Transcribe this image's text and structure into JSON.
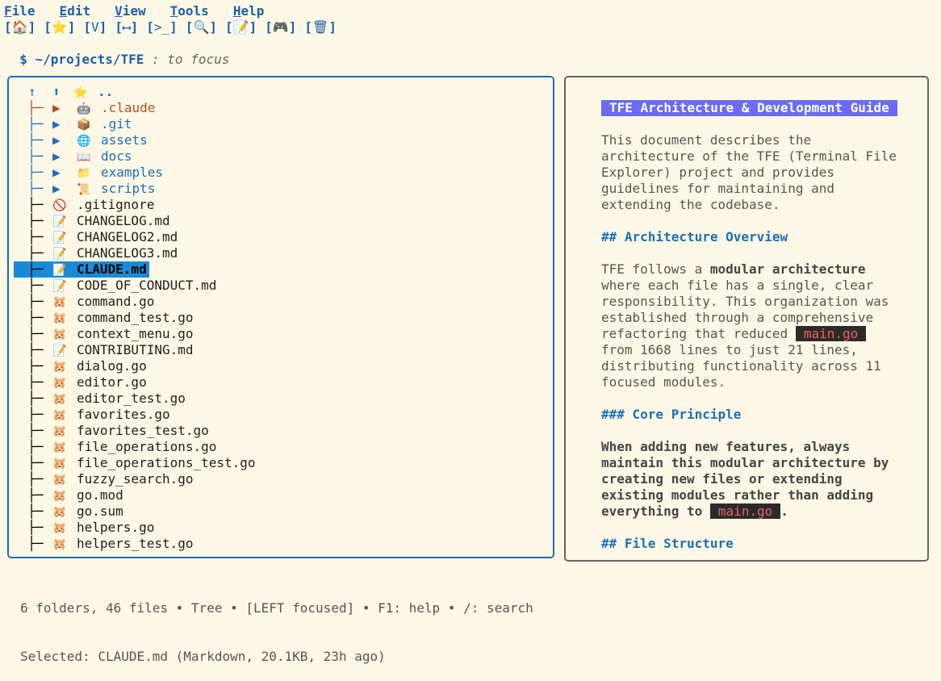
{
  "menu": [
    {
      "hotkey": "F",
      "rest": "ile"
    },
    {
      "hotkey": "E",
      "rest": "dit"
    },
    {
      "hotkey": "V",
      "rest": "iew"
    },
    {
      "hotkey": "T",
      "rest": "ools"
    },
    {
      "hotkey": "H",
      "rest": "elp"
    }
  ],
  "toolbar": [
    {
      "name": "home-button",
      "glyph": "🏠",
      "icon": "home-icon"
    },
    {
      "name": "favorites-button",
      "glyph": "⭐",
      "icon": "star-icon"
    },
    {
      "name": "view-button",
      "glyph": "V",
      "icon": "view-icon"
    },
    {
      "name": "toggle-panes-button",
      "glyph": "⟷",
      "icon": "arrows-icon"
    },
    {
      "name": "terminal-button",
      "glyph": ">_",
      "icon": "terminal-icon"
    },
    {
      "name": "search-button",
      "glyph": "🔍",
      "icon": "search-icon"
    },
    {
      "name": "edit-button",
      "glyph": "📝",
      "icon": "memo-icon"
    },
    {
      "name": "games-button",
      "glyph": "🎮",
      "icon": "gamepad-icon"
    },
    {
      "name": "trash-button",
      "glyph": "🗑",
      "icon": "trash-icon"
    }
  ],
  "command": {
    "prompt": "$ ~/projects/TFE",
    "hint": " : to focus"
  },
  "tree": {
    "parent": {
      "up": "↑",
      "top": "⬆",
      "icon": "⭐",
      "name": ".."
    },
    "rows": [
      {
        "kind": "claude",
        "arrow": "▶",
        "icon": "🤖",
        "name": ".claude"
      },
      {
        "kind": "folder",
        "arrow": "▶",
        "icon": "📦",
        "name": ".git"
      },
      {
        "kind": "folder",
        "arrow": "▶",
        "icon": "🌐",
        "name": "assets"
      },
      {
        "kind": "folder",
        "arrow": "▶",
        "icon": "📖",
        "name": "docs"
      },
      {
        "kind": "folder",
        "arrow": "▶",
        "icon": "📁",
        "name": "examples"
      },
      {
        "kind": "folder",
        "arrow": "▶",
        "icon": "📜",
        "name": "scripts"
      },
      {
        "kind": "file",
        "icon": "🚫",
        "name": ".gitignore"
      },
      {
        "kind": "file",
        "icon": "📝",
        "name": "CHANGELOG.md"
      },
      {
        "kind": "file",
        "icon": "📝",
        "name": "CHANGELOG2.md"
      },
      {
        "kind": "file",
        "icon": "📝",
        "name": "CHANGELOG3.md"
      },
      {
        "kind": "file",
        "icon": "📝",
        "name": "CLAUDE.md",
        "selected": true
      },
      {
        "kind": "file",
        "icon": "📝",
        "name": "CODE_OF_CONDUCT.md"
      },
      {
        "kind": "file",
        "icon": "🐹",
        "name": "command.go"
      },
      {
        "kind": "file",
        "icon": "🐹",
        "name": "command_test.go"
      },
      {
        "kind": "file",
        "icon": "🐹",
        "name": "context_menu.go"
      },
      {
        "kind": "file",
        "icon": "📝",
        "name": "CONTRIBUTING.md"
      },
      {
        "kind": "file",
        "icon": "🐹",
        "name": "dialog.go"
      },
      {
        "kind": "file",
        "icon": "🐹",
        "name": "editor.go"
      },
      {
        "kind": "file",
        "icon": "🐹",
        "name": "editor_test.go"
      },
      {
        "kind": "file",
        "icon": "🐹",
        "name": "favorites.go"
      },
      {
        "kind": "file",
        "icon": "🐹",
        "name": "favorites_test.go"
      },
      {
        "kind": "file",
        "icon": "🐹",
        "name": "file_operations.go"
      },
      {
        "kind": "file",
        "icon": "🐹",
        "name": "file_operations_test.go"
      },
      {
        "kind": "file",
        "icon": "🐹",
        "name": "fuzzy_search.go"
      },
      {
        "kind": "file",
        "icon": "🐹",
        "name": "go.mod"
      },
      {
        "kind": "file",
        "icon": "🐹",
        "name": "go.sum"
      },
      {
        "kind": "file",
        "icon": "🐹",
        "name": "helpers.go"
      },
      {
        "kind": "file",
        "icon": "🐹",
        "name": "helpers_test.go"
      }
    ]
  },
  "preview": {
    "lines": [
      [
        {
          "t": "title",
          "v": "TFE Architecture & Development Guide"
        }
      ],
      [],
      [
        {
          "t": "text",
          "v": "This document describes the"
        }
      ],
      [
        {
          "t": "text",
          "v": "architecture of the TFE (Terminal File"
        }
      ],
      [
        {
          "t": "text",
          "v": "Explorer) project and provides"
        }
      ],
      [
        {
          "t": "text",
          "v": "guidelines for maintaining and"
        }
      ],
      [
        {
          "t": "text",
          "v": "extending the codebase."
        }
      ],
      [],
      [
        {
          "t": "h",
          "v": "## Architecture Overview"
        }
      ],
      [],
      [
        {
          "t": "text",
          "v": "TFE follows a "
        },
        {
          "t": "b",
          "v": "modular architecture"
        }
      ],
      [
        {
          "t": "text",
          "v": "where each file has a single, clear"
        }
      ],
      [
        {
          "t": "text",
          "v": "responsibility. This organization was"
        }
      ],
      [
        {
          "t": "text",
          "v": "established through a comprehensive"
        }
      ],
      [
        {
          "t": "text",
          "v": "refactoring that reduced "
        },
        {
          "t": "code",
          "v": "main.go"
        }
      ],
      [
        {
          "t": "text",
          "v": "from 1668 lines to just 21 lines,"
        }
      ],
      [
        {
          "t": "text",
          "v": "distributing functionality across 11"
        }
      ],
      [
        {
          "t": "text",
          "v": "focused modules."
        }
      ],
      [],
      [
        {
          "t": "h",
          "v": "### Core Principle"
        }
      ],
      [],
      [
        {
          "t": "b",
          "v": "When adding new features, always"
        }
      ],
      [
        {
          "t": "b",
          "v": "maintain this modular architecture by"
        }
      ],
      [
        {
          "t": "b",
          "v": "creating new files or extending"
        }
      ],
      [
        {
          "t": "b",
          "v": "existing modules rather than adding"
        }
      ],
      [
        {
          "t": "b",
          "v": "everything to "
        },
        {
          "t": "code",
          "v": "main.go"
        },
        {
          "t": "b",
          "v": "."
        }
      ],
      [],
      [
        {
          "t": "h",
          "v": "## File Structure"
        }
      ]
    ]
  },
  "status": {
    "line1": "6 folders, 46 files • Tree • [LEFT focused] • F1: help • /: search",
    "line2": "Selected: CLAUDE.md (Markdown, 20.1KB, 23h ago)"
  }
}
